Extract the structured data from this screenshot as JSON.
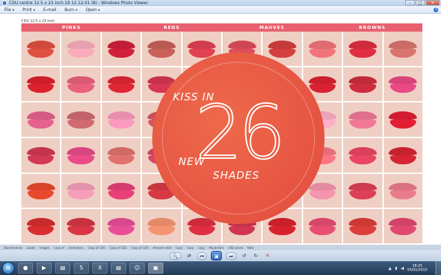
{
  "window": {
    "title": "CDU centre  12.5 x 23 inch 19 12 12-01 (8) - Windows Photo Viewer",
    "minimize": "–",
    "maximize": "□",
    "close": "✕"
  },
  "menu": {
    "items": [
      {
        "label": "File",
        "icon": "dropdown"
      },
      {
        "label": "Print",
        "icon": "dropdown"
      },
      {
        "label": "E-mail",
        "icon": ""
      },
      {
        "label": "Burn",
        "icon": "dropdown"
      },
      {
        "label": "Open",
        "icon": "dropdown"
      }
    ],
    "help": "?"
  },
  "image": {
    "caption": "CDU 12.5 x 23 inch",
    "categories": [
      "PINKS",
      "REDS",
      "MAUVES",
      "BROWNS"
    ],
    "badge": {
      "top": "KISS IN",
      "number": "26",
      "line2": "NEW",
      "line3": "SHADES"
    },
    "lip_colors": [
      "#cf4a3a",
      "#e7a0ae",
      "#c21d36",
      "#b85a52",
      "#d03c4b",
      "#cf4654",
      "#c43a3b",
      "#e06b72",
      "#cf2a3c",
      "#c96c66",
      "#cc1f2a",
      "#d95a74",
      "#cf2330",
      "#c8314a",
      "#d23e6a",
      "#c73a30",
      "#d84f74",
      "#c91f2e",
      "#c02a3a",
      "#d8447a",
      "#d55a84",
      "#c2626a",
      "#e88fb0",
      "#c74e5a",
      "#d6405c",
      "#cf3b43",
      "#b95a56",
      "#e9a3ba",
      "#df6f8c",
      "#d21b30",
      "#c3344e",
      "#d9457e",
      "#cf6a66",
      "#c8415e",
      "#de3f75",
      "#cb3a46",
      "#d34b71",
      "#e86d7a",
      "#d9405c",
      "#c7222f",
      "#d8432a",
      "#e592ad",
      "#d73b6e",
      "#c7353e",
      "#d54b66",
      "#cf2b45",
      "#cf3b3b",
      "#e38aa0",
      "#ce3a52",
      "#d97382",
      "#c92a2c",
      "#c8313f",
      "#d9488c",
      "#e4896a",
      "#cf2a3c",
      "#c2314a",
      "#c81f2a",
      "#d8476a",
      "#cc3a36",
      "#d0446a"
    ]
  },
  "filmstrip": {
    "thumbs": [
      "Bareminerals",
      "Labels",
      "Images",
      "Copy of",
      "animations",
      "Copy of CDU",
      "Copy of CDU",
      "Copy of CDU",
      "dressed retail",
      "Copy",
      "Copy",
      "Copy",
      "Maybelline",
      "CBD words",
      "Note"
    ]
  },
  "controls": {
    "zoom": "🔍",
    "fit": "⇄",
    "prev": "⏮",
    "slideshow": "▣",
    "next": "⏭",
    "rotate_left": "↺",
    "rotate_right": "↻",
    "delete": "✕"
  },
  "taskbar": {
    "icons": [
      {
        "name": "chrome",
        "glyph": "●"
      },
      {
        "name": "media-player",
        "glyph": "▶"
      },
      {
        "name": "folder",
        "glyph": "▤"
      },
      {
        "name": "skype",
        "glyph": "S"
      },
      {
        "name": "excel",
        "glyph": "X"
      },
      {
        "name": "folder-2",
        "glyph": "▤"
      },
      {
        "name": "messenger",
        "glyph": "☺"
      },
      {
        "name": "photo-viewer",
        "glyph": "▣"
      }
    ],
    "time": "18:25",
    "date": "05/01/2013",
    "colors": {
      "accent": "#2f64b8",
      "close": "#c84a32",
      "category_bar": "#e8606f",
      "badge": "#e24a3e"
    }
  }
}
